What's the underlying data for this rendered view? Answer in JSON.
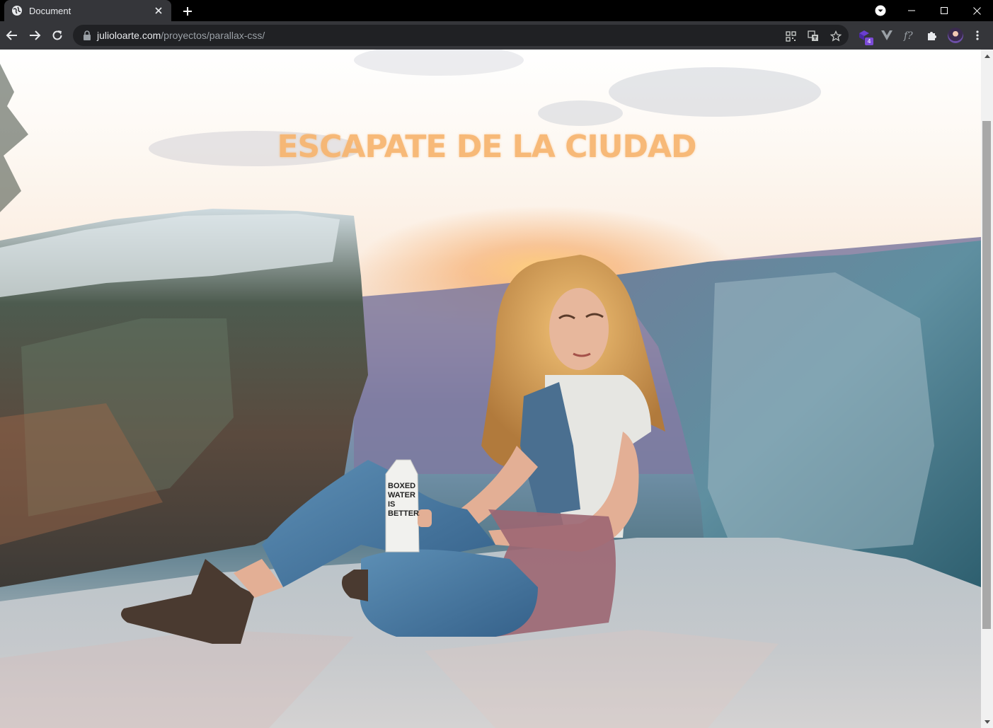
{
  "browser": {
    "tab_title": "Document",
    "url_host": "julioloarte.com",
    "url_path": "/proyectos/parallax-css/",
    "extension_badge": "4"
  },
  "page": {
    "hero_title": "ESCAPATE DE LA CIUDAD",
    "carton_text": [
      "BOXED",
      "WATER",
      "IS",
      "BETTER."
    ],
    "scroll_position": 0.1
  },
  "colors": {
    "title_color": "#f7b36b",
    "chrome_dark": "#35363a",
    "omnibox_bg": "#202124"
  }
}
